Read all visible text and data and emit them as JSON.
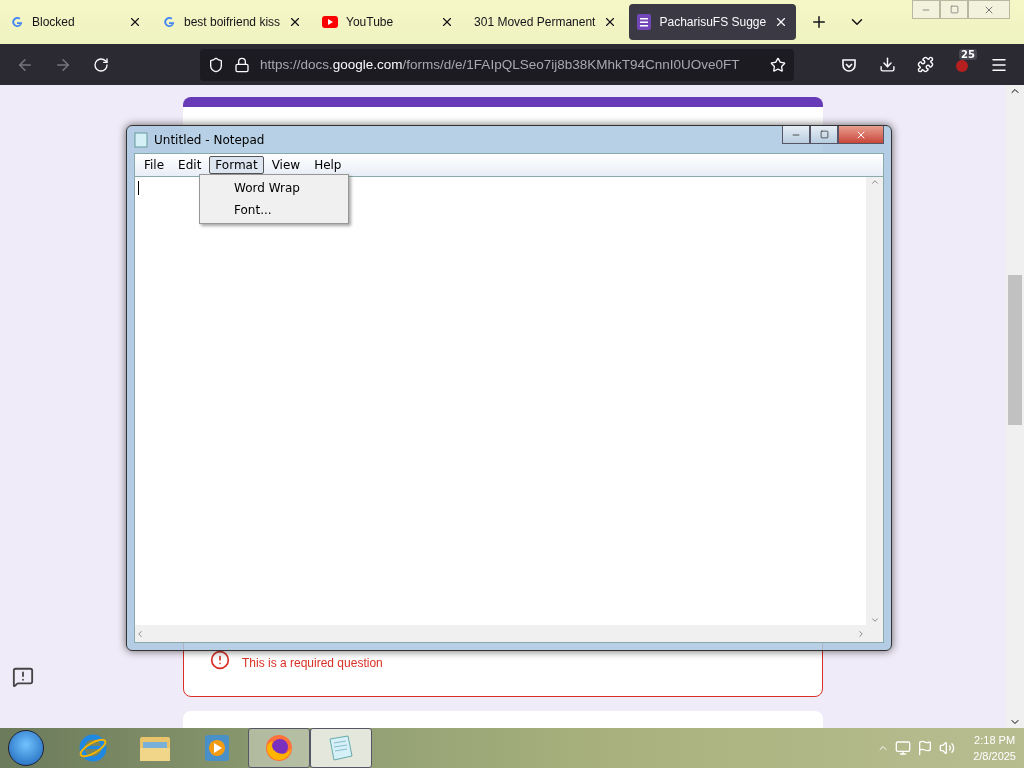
{
  "tabs": [
    {
      "title": "Blocked",
      "kind": "google",
      "selected": false
    },
    {
      "title": "best boifriend kiss",
      "kind": "google",
      "selected": false
    },
    {
      "title": "YouTube",
      "kind": "youtube",
      "selected": false
    },
    {
      "title": "301 Moved Permanent",
      "kind": "plain",
      "selected": false
    },
    {
      "title": "PacharisuFS Sugge",
      "kind": "forms",
      "selected": true
    }
  ],
  "address": {
    "prefix": "https://docs.",
    "domain": "google.com",
    "path": "/forms/d/e/1FAIpQLSeo7ij8b38KMhkT94CnnI0UOve0FT"
  },
  "extension_badge": "25",
  "form": {
    "error": "This is a required question"
  },
  "notepad": {
    "title": "Untitled - Notepad",
    "menu": [
      {
        "label": "File",
        "selected": false
      },
      {
        "label": "Edit",
        "selected": false
      },
      {
        "label": "Format",
        "selected": true
      },
      {
        "label": "View",
        "selected": false
      },
      {
        "label": "Help",
        "selected": false
      }
    ],
    "dropdown": [
      "Word Wrap",
      "Font..."
    ]
  },
  "taskbar": [
    {
      "kind": "ie",
      "open": false,
      "selected": false
    },
    {
      "kind": "explorer",
      "open": false,
      "selected": false
    },
    {
      "kind": "media",
      "open": false,
      "selected": false
    },
    {
      "kind": "firefox",
      "open": true,
      "selected": false
    },
    {
      "kind": "notepad",
      "open": true,
      "selected": true
    }
  ],
  "clock": {
    "time": "2:18 PM",
    "date": "2/8/2025"
  }
}
